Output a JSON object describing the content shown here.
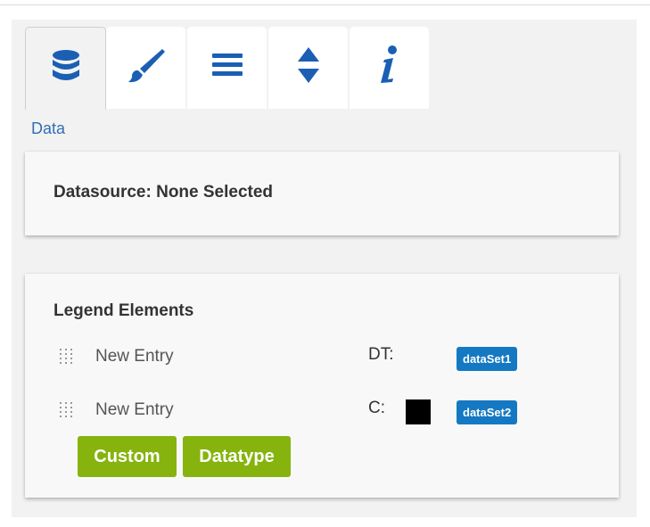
{
  "tabs": [
    {
      "icon": "database-icon",
      "active": true
    },
    {
      "icon": "brush-icon",
      "active": false
    },
    {
      "icon": "menu-lines-icon",
      "active": false
    },
    {
      "icon": "sort-arrows-icon",
      "active": false
    },
    {
      "icon": "info-icon",
      "active": false
    }
  ],
  "active_tab_label": "Data",
  "datasource": {
    "label": "Datasource: None Selected"
  },
  "legend": {
    "title": "Legend Elements",
    "entries": [
      {
        "label": "New Entry",
        "type_label": "DT:",
        "badge": "dataSet1",
        "swatch": null
      },
      {
        "label": "New Entry",
        "type_label": "C:",
        "badge": "dataSet2",
        "swatch": "#000000"
      }
    ],
    "buttons": {
      "custom": "Custom",
      "datatype": "Datatype"
    }
  },
  "colors": {
    "accent_blue": "#1479c2",
    "icon_blue": "#1a5fb4",
    "button_green": "#86b30d",
    "link_blue": "#2f6fb5"
  }
}
